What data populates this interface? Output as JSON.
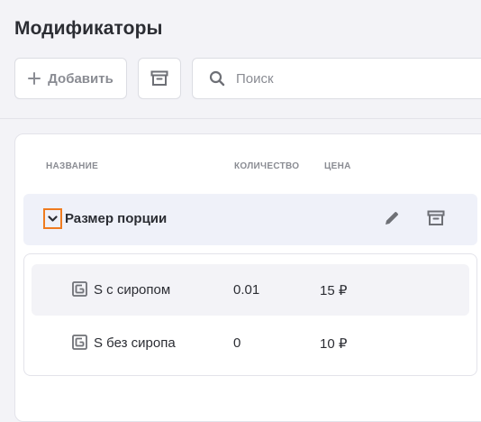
{
  "page": {
    "title": "Модификаторы"
  },
  "toolbar": {
    "add_label": "Добавить",
    "add_icon": "plus-icon",
    "archive_icon": "archive-icon",
    "search_placeholder": "Поиск",
    "search_value": "",
    "search_icon": "search-icon"
  },
  "table": {
    "columns": {
      "name": "НАЗВАНИЕ",
      "quantity": "КОЛИЧЕСТВО",
      "price": "ЦЕНА"
    },
    "group": {
      "name": "Размер порции",
      "expanded": true,
      "items": [
        {
          "name": "S с сиропом",
          "quantity": "0.01",
          "price": "15 ₽"
        },
        {
          "name": "S без сиропа",
          "quantity": "0",
          "price": "10 ₽"
        }
      ]
    }
  },
  "colors": {
    "accent_focus": "#ef7b1f",
    "background": "#f3f3f7",
    "group_row": "#eff1f9",
    "muted_text": "#8a8c93",
    "icon": "#6e7076"
  }
}
